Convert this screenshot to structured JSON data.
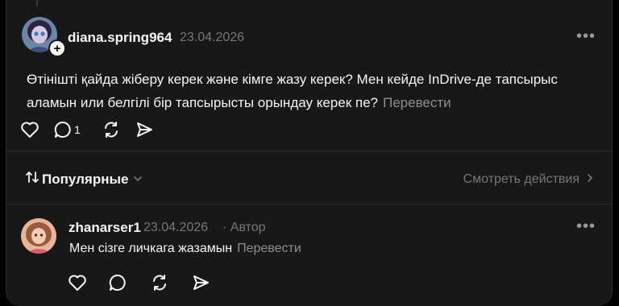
{
  "post": {
    "username": "diana.spring964",
    "date": "23.04.2026",
    "text": "Өтінішті қайда жіберу керек және кімге жазу керек? Мен кейде InDrive-де тапсырыс аламын или белгілі бір тапсырысты орындау керек пе?",
    "translate_label": "Перевести",
    "more": "•••",
    "reply_count": "1"
  },
  "toolbar": {
    "sort_label": "Популярные",
    "see_activity_label": "Смотреть действия"
  },
  "comment": {
    "username": "zhanarser1",
    "date": "23.04.2026",
    "author_badge": "· Автор",
    "text": "Мен сізге личкага жазамын",
    "translate_label": "Перевести",
    "more": "•••"
  },
  "colors": {
    "background": "#000000",
    "card": "#181818",
    "text": "#f3f5f7",
    "muted": "#777777",
    "divider": "#2d2d2d"
  }
}
